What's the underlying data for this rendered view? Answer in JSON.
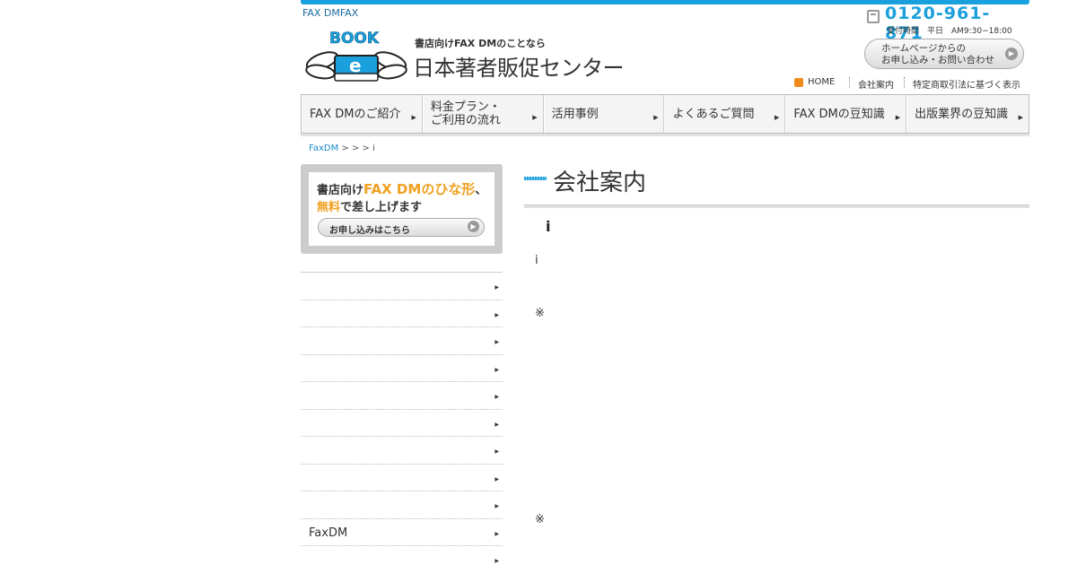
{
  "header": {
    "tagline": "FAX DMFAX",
    "site_subtitle": "書店向けFAX DMのことなら",
    "site_title": "日本著者販促センター",
    "logo_text": "BOOK",
    "logo_letter": "e",
    "phone": "0120-961-871",
    "hours": "受付時間　平日　AM9:30−18:00",
    "contact_btn_line1": "ホームページからの",
    "contact_btn_line2": "お申し込み・お問い合わせ",
    "util_links": [
      "HOME",
      "会社案内",
      "特定商取引法に基づく表示"
    ]
  },
  "gnav": [
    {
      "label": "FAX DMのご紹介"
    },
    {
      "label": "料金プラン・\nご利用の流れ"
    },
    {
      "label": "活用事例"
    },
    {
      "label": "よくあるご質問"
    },
    {
      "label": "FAX DMの豆知識"
    },
    {
      "label": "出版業界の豆知識"
    }
  ],
  "breadcrumb": {
    "link": "FaxDM",
    "rest": " >  >  >  i"
  },
  "banner": {
    "line1_a": "書店向け",
    "line1_b": "FAX DMのひな形",
    "line1_c": "、",
    "line2_a": "無料",
    "line2_b": "で差し上げます",
    "button": "お申し込みはこちら"
  },
  "side_items": [
    "",
    "",
    "",
    "",
    "",
    "",
    "",
    "",
    "",
    "FaxDM",
    ""
  ],
  "main": {
    "title": "会社案内",
    "subtitle": "i",
    "text1": "i",
    "note1": "※",
    "note2": "※"
  },
  "colors": {
    "accent": "#1aa0dc",
    "orange": "#f0a020"
  }
}
